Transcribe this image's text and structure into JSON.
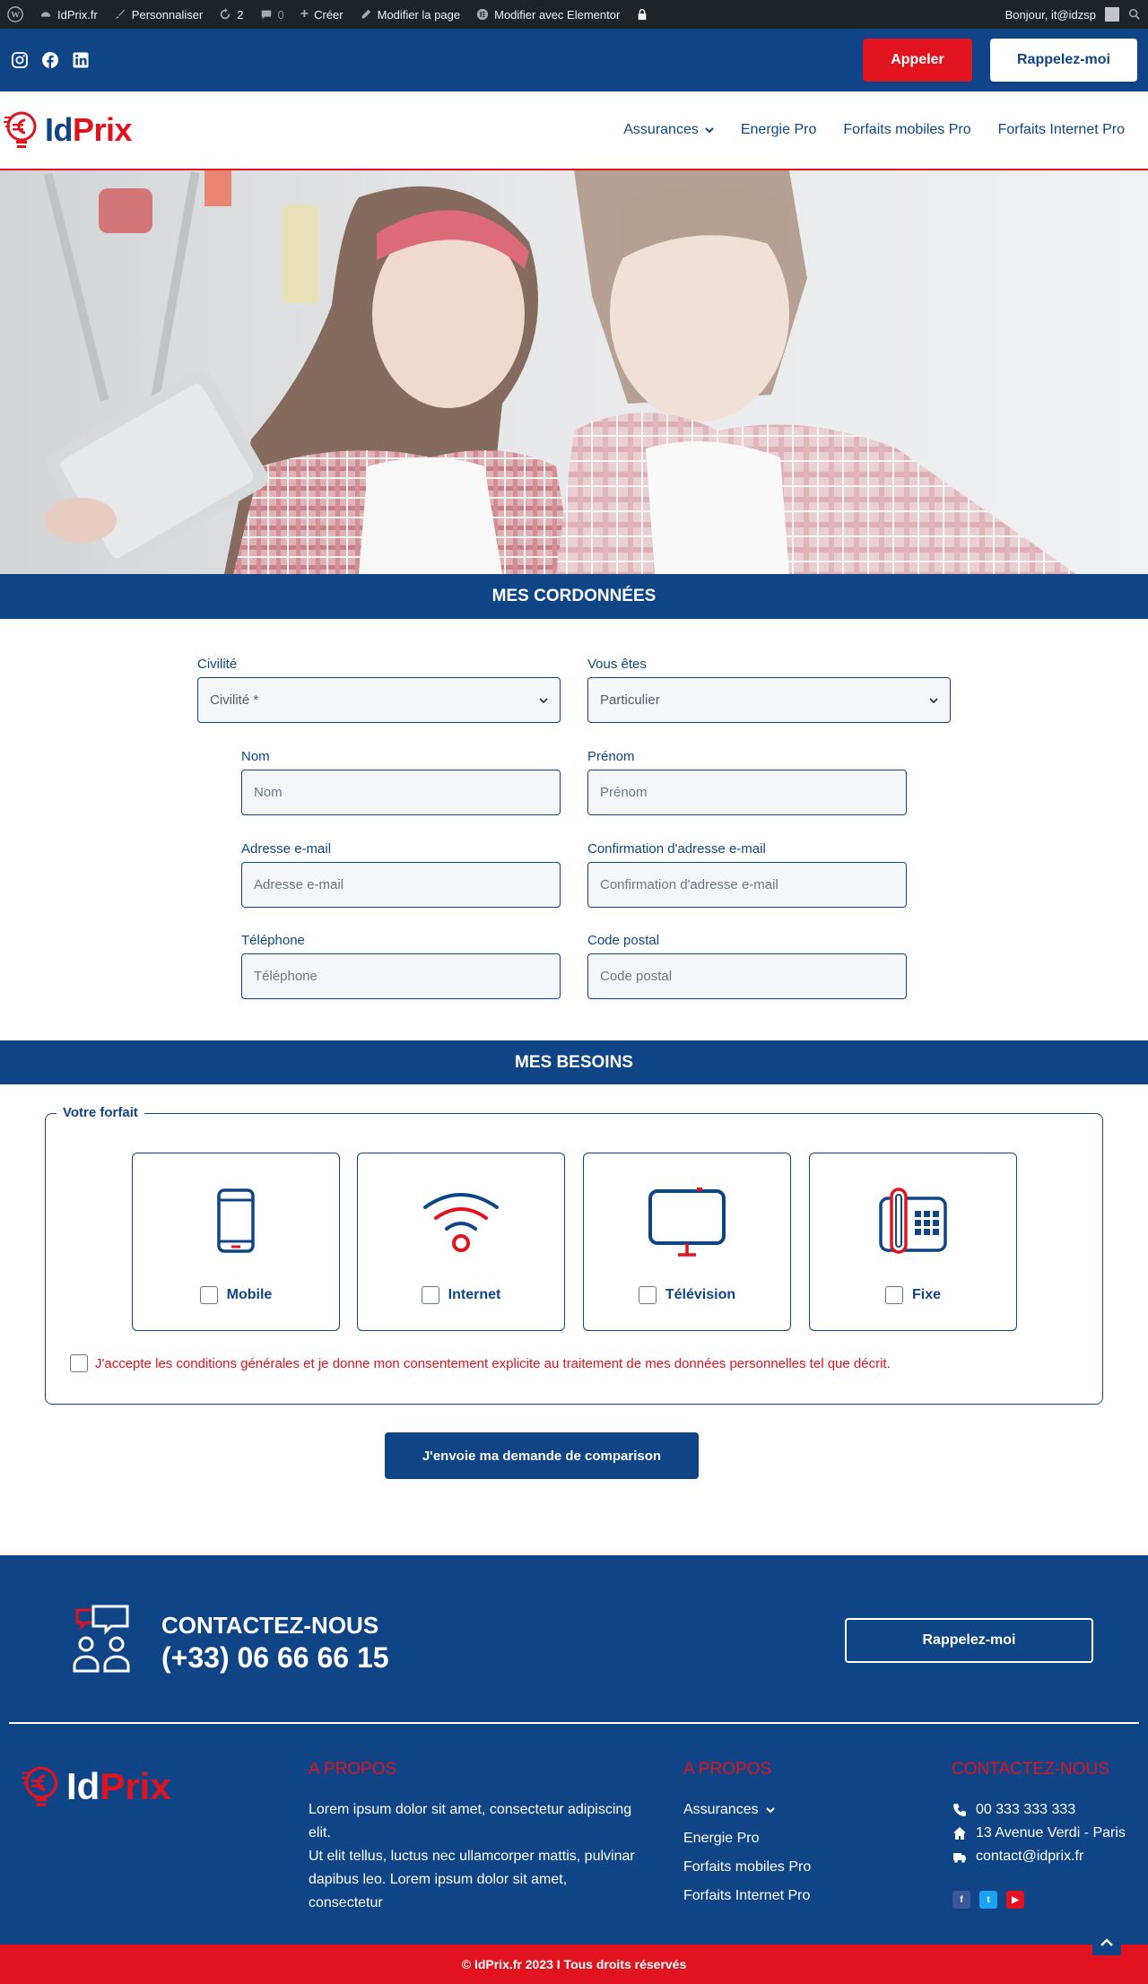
{
  "adminbar": {
    "site": "IdPrix.fr",
    "customize": "Personnaliser",
    "updates": "2",
    "comments": "0",
    "create": "Créer",
    "edit_page": "Modifier la page",
    "elementor": "Modifier avec Elementor",
    "greeting": "Bonjour, it@idzsp"
  },
  "topbar": {
    "call_label": "Appeler",
    "callback_label": "Rappelez-moi",
    "social_icons": [
      "instagram-icon",
      "facebook-icon",
      "linkedin-icon"
    ]
  },
  "header": {
    "logo_id": "Id",
    "logo_prix": "Prix",
    "nav": [
      "Assurances",
      "Energie Pro",
      "Forfaits mobiles Pro",
      "Forfaits Internet Pro"
    ]
  },
  "sections": {
    "coordonnees": "MES CORDONNÉES",
    "besoins": "MES BESOINS"
  },
  "form": {
    "civilite": {
      "label": "Civilité",
      "value": "Civilité *"
    },
    "vous_etes": {
      "label": "Vous êtes",
      "value": "Particulier"
    },
    "nom": {
      "label": "Nom",
      "placeholder": "Nom"
    },
    "prenom": {
      "label": "Prénom",
      "placeholder": "Prénom"
    },
    "email": {
      "label": "Adresse e-mail",
      "placeholder": "Adresse e-mail"
    },
    "email_confirm": {
      "label": "Confirmation d'adresse e-mail",
      "placeholder": "Confirmation d'adresse e-mail"
    },
    "telephone": {
      "label": "Téléphone",
      "placeholder": "Téléphone"
    },
    "code_postal": {
      "label": "Code postal",
      "placeholder": "Code postal"
    }
  },
  "forfait": {
    "legend": "Votre forfait",
    "options": [
      "Mobile",
      "Internet",
      "Télévision",
      "Fixe"
    ],
    "consent": "J'accepte les conditions générales et je donne mon consentement explicite au traitement de mes données personnelles tel que décrit.",
    "submit": "J'envoie ma demande de comparison"
  },
  "footer": {
    "contact_title": "CONTACTEZ-NOUS",
    "contact_phone": "(+33) 06 66 66 15",
    "callback_label": "Rappelez-moi",
    "about_title": "A PROPOS",
    "about_text_1": "Lorem ipsum dolor sit amet, consectetur adipiscing elit.",
    "about_text_2": "Ut elit tellus, luctus nec ullamcorper mattis, pulvinar dapibus leo. Lorem ipsum dolor sit amet, consectetur",
    "links_title": "A PROPOS",
    "links": [
      "Assurances",
      "Energie Pro",
      "Forfaits mobiles Pro",
      "Forfaits Internet Pro"
    ],
    "contact_col_title": "CONTACTEZ-NOUS",
    "phone": "00 333 333 333",
    "address": "13 Avenue Verdi - Paris",
    "email": "contact@idprix.fr",
    "copyright": "© IdPrix.fr 2023 I Tous droits réservés"
  },
  "colors": {
    "navy": "#0f4587",
    "red": "#e0131e",
    "admin_bar": "#1d2327"
  }
}
